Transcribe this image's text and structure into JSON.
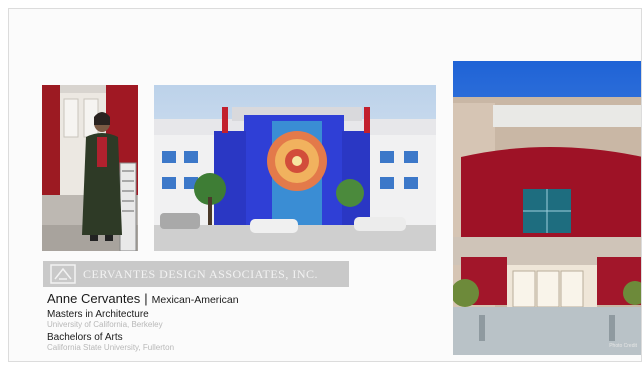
{
  "banner": {
    "logo_text": "CERVANTES DESIGN ASSOCIATES, INC."
  },
  "profile": {
    "name": "Anne Cervantes",
    "separator": "|",
    "heritage": "Mexican-American",
    "education": [
      {
        "degree": "Masters in Architecture",
        "school": "University of California, Berkeley"
      },
      {
        "degree": "Bachelors of Arts",
        "school": "California State University, Fullerton"
      }
    ]
  },
  "photos": {
    "portrait": "portrait-photo",
    "building_blue": "school-building-photo",
    "building_red": "red-building-photo",
    "credit": "Photo Credit"
  },
  "colors": {
    "accent_blue": "#2f3fd6",
    "accent_red": "#a3132a",
    "banner_gray": "#c9c9c9"
  }
}
